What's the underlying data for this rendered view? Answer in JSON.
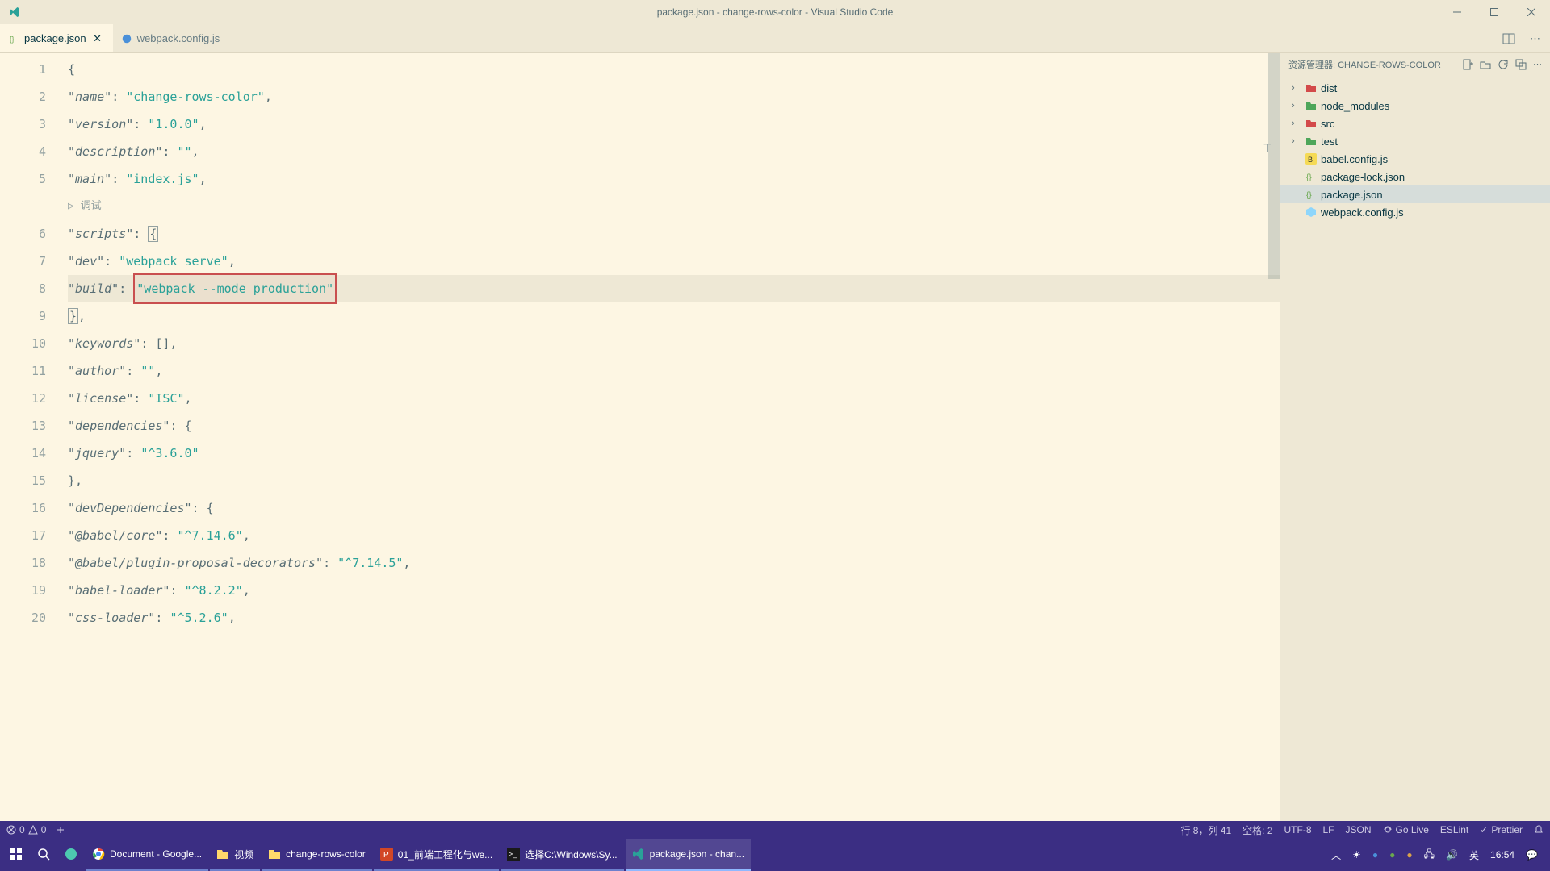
{
  "window": {
    "title": "package.json - change-rows-color - Visual Studio Code"
  },
  "tabs": [
    {
      "label": "package.json",
      "active": true,
      "icon": "json"
    },
    {
      "label": "webpack.config.js",
      "active": false,
      "icon": "js"
    }
  ],
  "sidebar": {
    "title": "资源管理器: CHANGE-ROWS-COLOR",
    "folders": [
      {
        "name": "dist",
        "type": "folder",
        "color": "#d34a4a"
      },
      {
        "name": "node_modules",
        "type": "folder",
        "color": "#4ea65a"
      },
      {
        "name": "src",
        "type": "folder",
        "color": "#d34a4a"
      },
      {
        "name": "test",
        "type": "folder",
        "color": "#4ea65a"
      }
    ],
    "files": [
      {
        "name": "babel.config.js",
        "icon": "babel"
      },
      {
        "name": "package-lock.json",
        "icon": "json"
      },
      {
        "name": "package.json",
        "icon": "json",
        "selected": true
      },
      {
        "name": "webpack.config.js",
        "icon": "webpack"
      }
    ]
  },
  "editor": {
    "debug_hint": "调试",
    "lines": [
      {
        "n": 1,
        "type": "brace",
        "text": "{"
      },
      {
        "n": 2,
        "type": "kv",
        "key": "\"name\"",
        "value": "\"change-rows-color\"",
        "comma": true
      },
      {
        "n": 3,
        "type": "kv",
        "key": "\"version\"",
        "value": "\"1.0.0\"",
        "comma": true
      },
      {
        "n": 4,
        "type": "kv",
        "key": "\"description\"",
        "value": "\"\"",
        "comma": true
      },
      {
        "n": 5,
        "type": "kv",
        "key": "\"main\"",
        "value": "\"index.js\"",
        "comma": true
      },
      {
        "n": 6,
        "type": "kv-brace",
        "key": "\"scripts\"",
        "brace": "{"
      },
      {
        "n": 7,
        "type": "kv2",
        "key": "\"dev\"",
        "value": "\"webpack serve\"",
        "comma": true
      },
      {
        "n": 8,
        "type": "kv2-hl",
        "key": "\"build\"",
        "value": "\"webpack --mode production\""
      },
      {
        "n": 9,
        "type": "close-brace",
        "text": "},",
        "indent": 1
      },
      {
        "n": 10,
        "type": "kv-arr",
        "key": "\"keywords\"",
        "value": "[]",
        "comma": true
      },
      {
        "n": 11,
        "type": "kv",
        "key": "\"author\"",
        "value": "\"\"",
        "comma": true
      },
      {
        "n": 12,
        "type": "kv",
        "key": "\"license\"",
        "value": "\"ISC\"",
        "comma": true
      },
      {
        "n": 13,
        "type": "kv-brace",
        "key": "\"dependencies\"",
        "brace": "{"
      },
      {
        "n": 14,
        "type": "kv2",
        "key": "\"jquery\"",
        "value": "\"^3.6.0\""
      },
      {
        "n": 15,
        "type": "close-brace",
        "text": "},",
        "indent": 1
      },
      {
        "n": 16,
        "type": "kv-brace",
        "key": "\"devDependencies\"",
        "brace": "{"
      },
      {
        "n": 17,
        "type": "kv2",
        "key": "\"@babel/core\"",
        "value": "\"^7.14.6\"",
        "comma": true
      },
      {
        "n": 18,
        "type": "kv2",
        "key": "\"@babel/plugin-proposal-decorators\"",
        "value": "\"^7.14.5\"",
        "comma": true
      },
      {
        "n": 19,
        "type": "kv2",
        "key": "\"babel-loader\"",
        "value": "\"^8.2.2\"",
        "comma": true
      },
      {
        "n": 20,
        "type": "kv2",
        "key": "\"css-loader\"",
        "value": "\"^5.2.6\"",
        "comma": true
      }
    ]
  },
  "status": {
    "errors": "0",
    "warnings": "0",
    "line_col": "行 8，列 41",
    "spaces": "空格: 2",
    "encoding": "UTF-8",
    "eol": "LF",
    "lang": "JSON",
    "golive": "Go Live",
    "eslint": "ESLint",
    "prettier": "Prettier"
  },
  "taskbar": {
    "items": [
      {
        "label": "",
        "icon": "windows"
      },
      {
        "label": "",
        "icon": "search"
      },
      {
        "label": "",
        "icon": "edge"
      },
      {
        "label": "Document - Google...",
        "icon": "chrome"
      },
      {
        "label": "视频",
        "icon": "folder"
      },
      {
        "label": "change-rows-color",
        "icon": "folder2"
      },
      {
        "label": "01_前端工程化与we...",
        "icon": "ppt"
      },
      {
        "label": "选择C:\\Windows\\Sy...",
        "icon": "cmd"
      },
      {
        "label": "package.json - chan...",
        "icon": "vscode",
        "active": true
      }
    ],
    "tray": {
      "ime": "英",
      "time": "16:54"
    }
  }
}
